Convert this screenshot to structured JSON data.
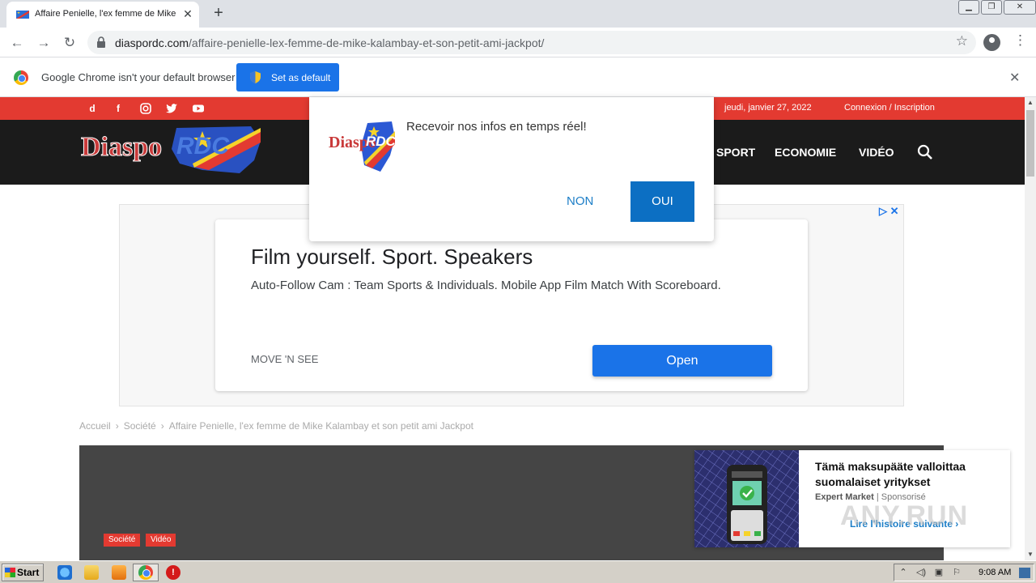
{
  "browser": {
    "tab_title": "Affaire Penielle, l'ex femme de Mike Kalambay",
    "url_domain": "diaspordc.com",
    "url_path": "/affaire-penielle-lex-femme-de-mike-kalambay-et-son-petit-ami-jackpot/",
    "infobar_text": "Google Chrome isn't your default browser",
    "set_default_label": "Set as default"
  },
  "site": {
    "date": "jeudi, janvier 27, 2022",
    "login": "Connexion / Inscription",
    "logo_text_a": "Diaspo",
    "logo_text_b": "RDC",
    "nav": [
      "SPORT",
      "ECONOMIE",
      "VIDÉO"
    ]
  },
  "notification": {
    "logo_text_a": "Diaspo",
    "logo_text_b": "RDC",
    "message": "Recevoir nos infos en temps réel!",
    "decline": "NON",
    "accept": "OUI"
  },
  "ad": {
    "title": "Film yourself. Sport. Speakers",
    "description": "Auto-Follow Cam : Team Sports & Individuals. Mobile App Film Match With Scoreboard.",
    "brand": "MOVE 'N SEE",
    "cta": "Open"
  },
  "breadcrumb": {
    "home": "Accueil",
    "category": "Société",
    "current": "Affaire Penielle, l'ex femme de Mike Kalambay et son petit ami Jackpot"
  },
  "article": {
    "tags": [
      "Société",
      "Vidéo"
    ]
  },
  "sponsored": {
    "title": "Tämä maksupääte valloittaa suomalaiset yritykset",
    "source": "Expert Market",
    "label": "Sponsorisé",
    "read_more": "Lire l'histoire suivante ›"
  },
  "watermark": "ANY.RUN",
  "taskbar": {
    "start": "Start",
    "clock": "9:08 AM"
  },
  "colors": {
    "brand_red": "#e33a31",
    "header_dark": "#1b1b1b",
    "chrome_blue": "#1a73e8",
    "popup_blue": "#0c6fc3"
  }
}
